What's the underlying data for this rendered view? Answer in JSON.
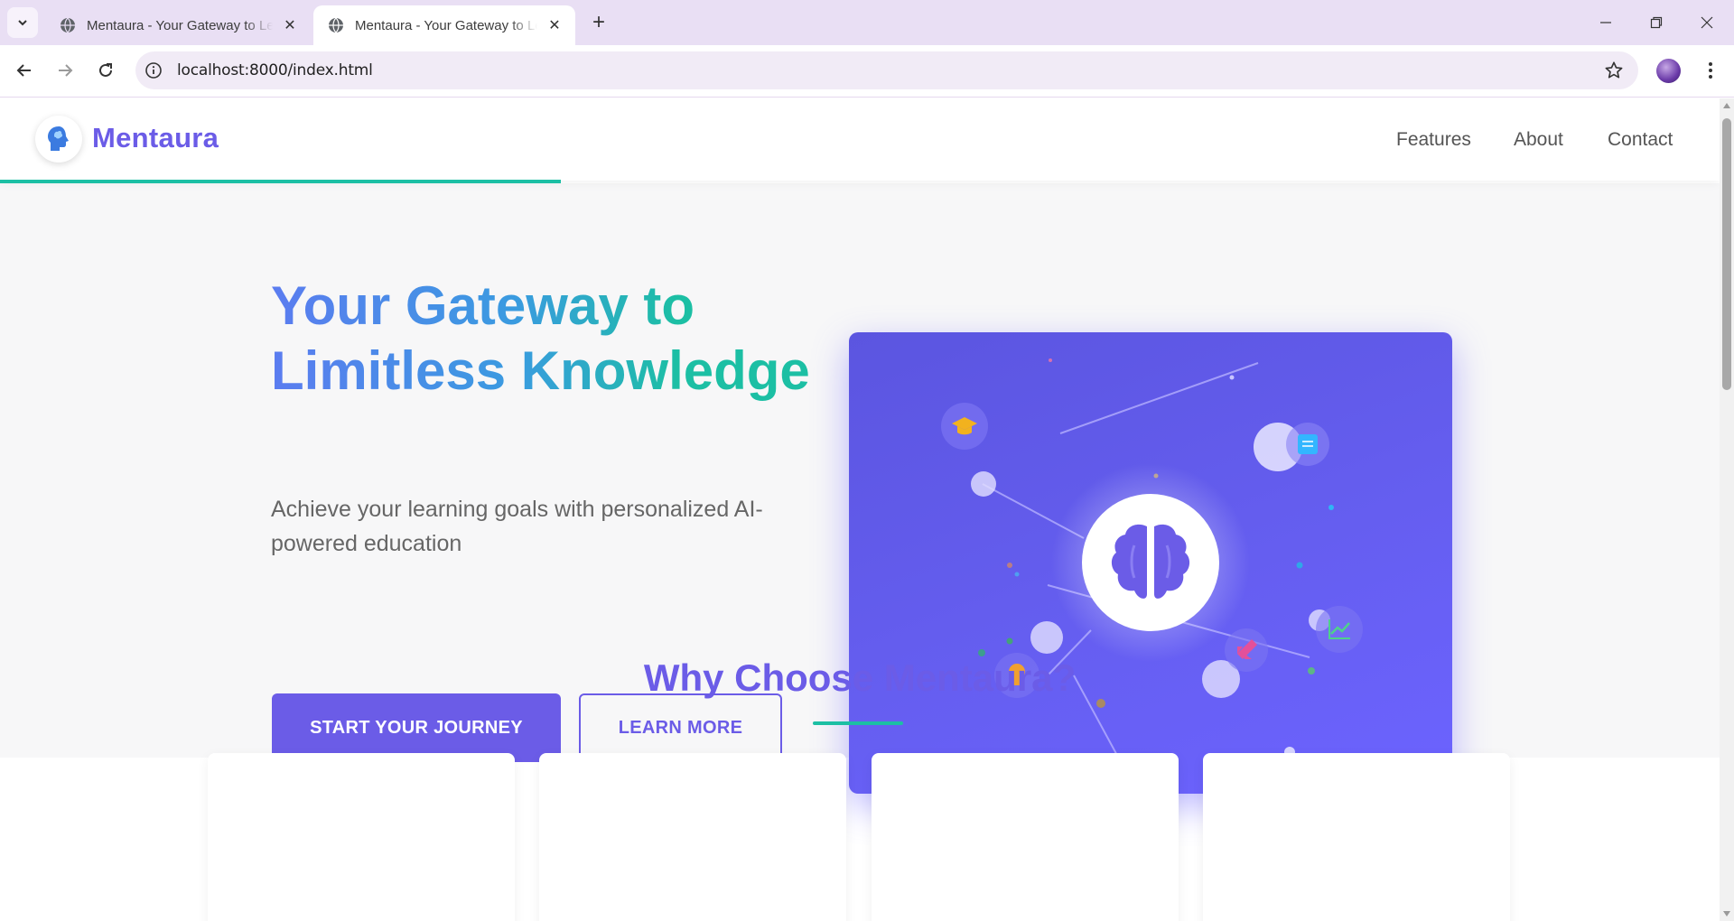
{
  "browser": {
    "tabs": [
      {
        "title": "Mentaura - Your Gateway to Learning",
        "active": false
      },
      {
        "title": "Mentaura - Your Gateway to Learning",
        "active": true
      }
    ],
    "url": "localhost:8000/index.html",
    "icons": [
      "tab-list-icon",
      "globe-icon",
      "close-icon",
      "plus-icon",
      "minimize-icon",
      "restore-icon",
      "window-close-icon",
      "back-icon",
      "forward-icon",
      "reload-icon",
      "info-icon",
      "star-icon",
      "menu-dots-icon"
    ]
  },
  "site": {
    "brand": "Mentaura",
    "nav": [
      {
        "label": "Features"
      },
      {
        "label": "About"
      },
      {
        "label": "Contact"
      }
    ],
    "scroll_progress": 0.326,
    "colors": {
      "primary": "#6b5ce7",
      "accent": "#1cbfa4",
      "hero_bg": "#f7f7f8"
    }
  },
  "hero": {
    "title": "Your Gateway to Limitless Knowledge",
    "subtitle": "Achieve your learning goals with personalized AI-powered education",
    "primary_cta": "START YOUR JOURNEY",
    "secondary_cta": "LEARN MORE",
    "illustration_icons": [
      "brain-icon",
      "graduation-cap-icon",
      "book-icon",
      "chart-icon",
      "rocket-icon",
      "lightbulb-icon"
    ]
  },
  "features": {
    "title": "Why Choose Mentaura?"
  }
}
